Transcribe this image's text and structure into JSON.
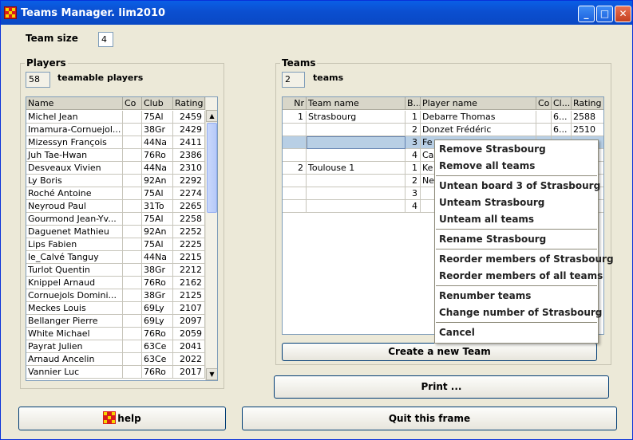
{
  "window": {
    "title": "Teams Manager. lim2010",
    "min": "_",
    "max": "□",
    "close": "✕"
  },
  "team_size": {
    "label": "Team size",
    "value": "4"
  },
  "players": {
    "title": "Players",
    "count": "58",
    "count_label": "teamable players",
    "columns": [
      "Name",
      "Co",
      "Club",
      "Rating"
    ],
    "rows": [
      [
        "Michel Jean",
        "",
        "75Al",
        "2459"
      ],
      [
        "Imamura-Cornuejol...",
        "",
        "38Gr",
        "2429"
      ],
      [
        "Mizessyn François",
        "",
        "44Na",
        "2411"
      ],
      [
        "Juh Tae-Hwan",
        "",
        "76Ro",
        "2386"
      ],
      [
        "Desveaux Vivien",
        "",
        "44Na",
        "2310"
      ],
      [
        "Ly Boris",
        "",
        "92An",
        "2292"
      ],
      [
        "Roché Antoine",
        "",
        "75Al",
        "2274"
      ],
      [
        "Neyroud Paul",
        "",
        "31To",
        "2265"
      ],
      [
        "Gourmond Jean-Yv...",
        "",
        "75Al",
        "2258"
      ],
      [
        "Daguenet Mathieu",
        "",
        "92An",
        "2252"
      ],
      [
        "Lips Fabien",
        "",
        "75Al",
        "2225"
      ],
      [
        "le_Calvé Tanguy",
        "",
        "44Na",
        "2215"
      ],
      [
        "Turlot Quentin",
        "",
        "38Gr",
        "2212"
      ],
      [
        "Knippel Arnaud",
        "",
        "76Ro",
        "2162"
      ],
      [
        "Cornuejols Domini...",
        "",
        "38Gr",
        "2125"
      ],
      [
        "Meckes Louis",
        "",
        "69Ly",
        "2107"
      ],
      [
        "Bellanger Pierre",
        "",
        "69Ly",
        "2097"
      ],
      [
        "White Michael",
        "",
        "76Ro",
        "2059"
      ],
      [
        "Payrat Julien",
        "",
        "63Ce",
        "2041"
      ],
      [
        "Arnaud Ancelin",
        "",
        "63Ce",
        "2022"
      ],
      [
        "Vannier Luc",
        "",
        "76Ro",
        "2017"
      ]
    ]
  },
  "teams": {
    "title": "Teams",
    "count": "2",
    "count_label": "teams",
    "columns": [
      "Nr",
      "Team name",
      "B...",
      "Player name",
      "Co",
      "Cl...",
      "Rating"
    ],
    "rows": [
      [
        "1",
        "Strasbourg",
        "1",
        "Debarre Thomas",
        "",
        "6...",
        "2588"
      ],
      [
        "",
        "",
        "2",
        "Donzet Frédéric",
        "",
        "6...",
        "2510"
      ],
      [
        "",
        "",
        "3",
        "Fe",
        "",
        "",
        ""
      ],
      [
        "",
        "",
        "4",
        "Ca",
        "",
        "",
        ""
      ],
      [
        "2",
        "Toulouse 1",
        "1",
        "Ke",
        "",
        "",
        ""
      ],
      [
        "",
        "",
        "2",
        "Ne",
        "",
        "",
        ""
      ],
      [
        "",
        "",
        "3",
        "",
        "",
        "",
        ""
      ],
      [
        "",
        "",
        "4",
        "",
        "",
        "",
        ""
      ]
    ]
  },
  "context_menu": {
    "items": [
      "Remove Strasbourg",
      "Remove all teams",
      "Untean board 3 of Strasbourg",
      "Unteam Strasbourg",
      "Unteam all teams",
      "Rename Strasbourg",
      "Reorder members of Strasbourg",
      "Reorder members of all teams",
      "Renumber teams",
      "Change number of Strasbourg",
      "Cancel"
    ]
  },
  "buttons": {
    "create_team": "Create a new Team",
    "print": "Print ...",
    "help": "help",
    "quit": "Quit this frame"
  },
  "colors": {
    "selection": "#b8cfe5",
    "titlebar": "#0b4fd0"
  }
}
